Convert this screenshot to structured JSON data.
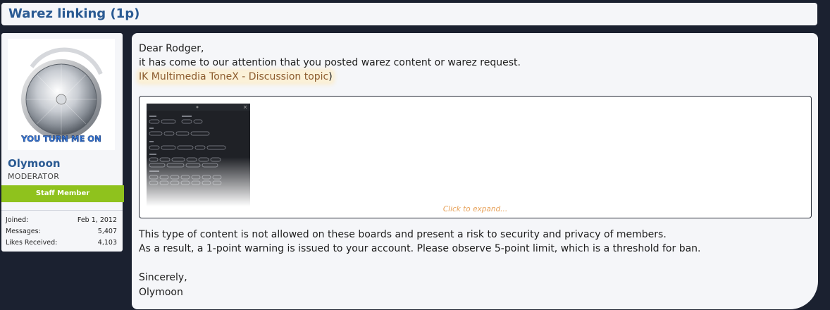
{
  "header": {
    "title": "Warez linking (1p)"
  },
  "user": {
    "avatar_caption": "YOU TURN ME ON",
    "name": "Olymoon",
    "title": "MODERATOR",
    "banner": "Staff Member",
    "stats": [
      {
        "label": "Joined:",
        "value": "Feb 1, 2012"
      },
      {
        "label": "Messages:",
        "value": "5,407"
      },
      {
        "label": "Likes Received:",
        "value": "4,103"
      }
    ]
  },
  "post": {
    "greeting": "Dear Rodger,",
    "intro": "it has come to our attention that you posted warez content or warez request.",
    "link_text": "IK Multimedia ToneX - Discussion topic",
    "link_close": ")",
    "expand_label": "Click to expand...",
    "body1": "This type of content is not allowed on these boards and present a risk to security and privacy of members.",
    "body2": "As a result, a 1-point warning is issued to your account. Please observe 5-point limit, which is a threshold for ban.",
    "closing": "Sincerely,",
    "signature": "Olymoon"
  },
  "colors": {
    "accent": "#2a5a93",
    "staff": "#8fc21d",
    "expand": "#e7a25a",
    "background": "#1b2130"
  }
}
